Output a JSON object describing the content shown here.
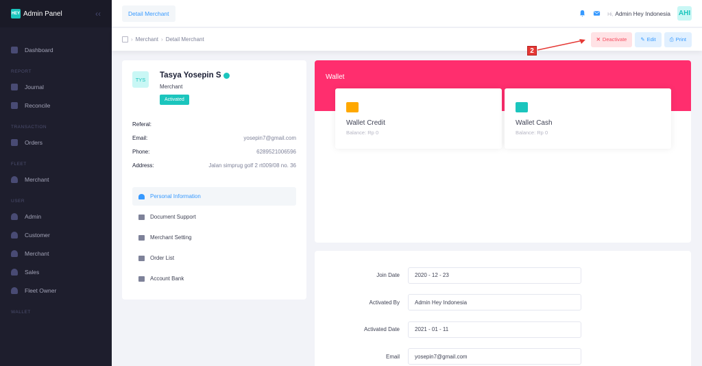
{
  "sidebar": {
    "brand": "Admin Panel",
    "logo_text": "HEY",
    "items": [
      {
        "type": "item",
        "label": "Dashboard",
        "icon": "home-icon"
      },
      {
        "type": "section",
        "label": "REPORT"
      },
      {
        "type": "item",
        "label": "Journal",
        "icon": "clipboard-icon"
      },
      {
        "type": "item",
        "label": "Reconcile",
        "icon": "clipboard-icon"
      },
      {
        "type": "section",
        "label": "TRANSACTION"
      },
      {
        "type": "item",
        "label": "Orders",
        "icon": "cart-icon"
      },
      {
        "type": "section",
        "label": "FLEET"
      },
      {
        "type": "item",
        "label": "Merchant",
        "icon": "user-icon"
      },
      {
        "type": "section",
        "label": "USER"
      },
      {
        "type": "item",
        "label": "Admin",
        "icon": "user-icon"
      },
      {
        "type": "item",
        "label": "Customer",
        "icon": "user-icon"
      },
      {
        "type": "item",
        "label": "Merchant",
        "icon": "user-icon"
      },
      {
        "type": "item",
        "label": "Sales",
        "icon": "user-icon"
      },
      {
        "type": "item",
        "label": "Fleet Owner",
        "icon": "user-icon"
      },
      {
        "type": "section",
        "label": "WALLET"
      }
    ]
  },
  "header": {
    "tab": "Detail Merchant",
    "hi": "Hi,",
    "user": "Admin Hey Indonesia",
    "avatar": "AHI"
  },
  "breadcrumb": {
    "items": [
      "Merchant",
      "Detail Merchant"
    ]
  },
  "actions": {
    "deactivate": "Deactivate",
    "edit": "Edit",
    "print": "Print"
  },
  "annotation": {
    "number": "2",
    "color": "#e53935"
  },
  "profile": {
    "initials": "TYS",
    "name": "Tasya Yosepin S",
    "role": "Merchant",
    "status": "Activated",
    "info": [
      {
        "key": "Referal:",
        "value": ""
      },
      {
        "key": "Email:",
        "value": "yosepin7@gmail.com"
      },
      {
        "key": "Phone:",
        "value": "6289521006596"
      },
      {
        "key": "Address:",
        "value": "Jalan simprug golf 2 rt009/08 no. 36"
      }
    ],
    "nav": [
      {
        "label": "Personal Information",
        "icon": "user-icon",
        "active": true
      },
      {
        "label": "Document Support",
        "icon": "layers-icon",
        "active": false
      },
      {
        "label": "Merchant Setting",
        "icon": "layers-icon",
        "active": false
      },
      {
        "label": "Order List",
        "icon": "cart-icon",
        "active": false
      },
      {
        "label": "Account Bank",
        "icon": "card-icon",
        "active": false
      }
    ]
  },
  "wallet": {
    "title": "Wallet",
    "tiles": [
      {
        "title": "Wallet Credit",
        "balance": "Balance: Rp 0",
        "color": "#ffa800",
        "icon": "folder-icon"
      },
      {
        "title": "Wallet Cash",
        "balance": "Balance: Rp 0",
        "color": "#1bc5bd",
        "icon": "wallet-icon"
      }
    ]
  },
  "details": [
    {
      "label": "Join Date",
      "value": "2020 - 12 - 23"
    },
    {
      "label": "Activated By",
      "value": "Admin Hey Indonesia"
    },
    {
      "label": "Activated Date",
      "value": "2021 - 01 - 11"
    },
    {
      "label": "Email",
      "value": "yosepin7@gmail.com"
    }
  ]
}
